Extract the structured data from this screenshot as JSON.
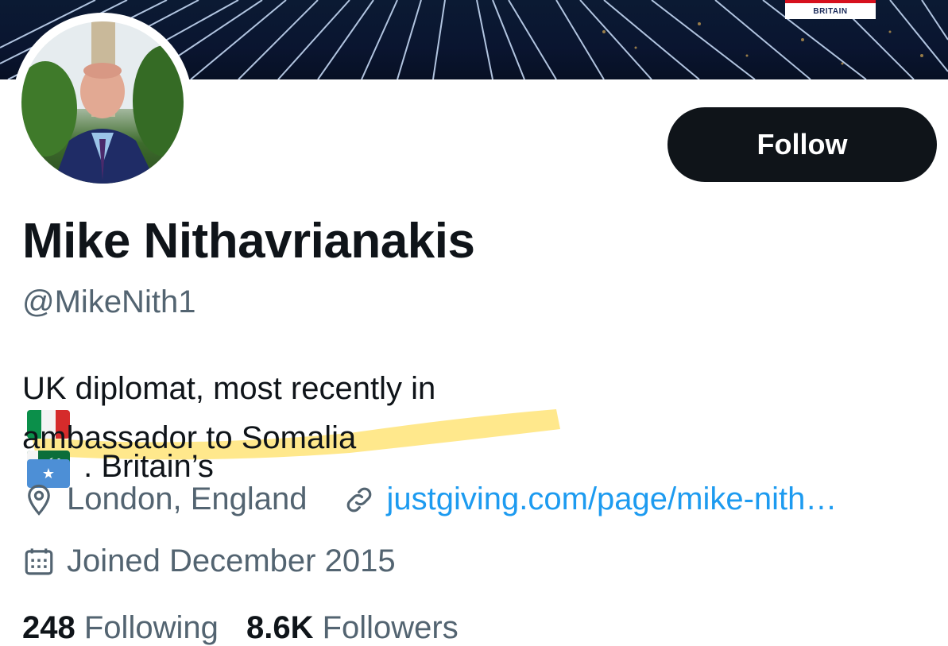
{
  "banner": {
    "badge_text": "BRITAIN",
    "colors": {
      "background": "#0b1a33",
      "lines": "#cfe3ff",
      "badge_red": "#d6101d"
    }
  },
  "profile": {
    "display_name": "Mike Nithavrianakis",
    "handle": "@MikeNith1",
    "follow_label": "Follow",
    "bio": {
      "line1_a": "UK diplomat, most recently in",
      "line1_b": ". Britain’s",
      "line2": "ambassador to Somalia",
      "flags": [
        "italy-flag",
        "pakistan-flag",
        "somalia-flag"
      ]
    },
    "location": "London, England",
    "website": "justgiving.com/page/mike-nith…",
    "joined": "Joined December 2015"
  },
  "stats": {
    "following_count": "248",
    "following_label": "Following",
    "followers_count": "8.6K",
    "followers_label": "Followers"
  },
  "colors": {
    "text_primary": "#0f1419",
    "text_secondary": "#536471",
    "link": "#1d9bf0",
    "button_bg": "#0f1419",
    "highlight": "#ffe066"
  }
}
